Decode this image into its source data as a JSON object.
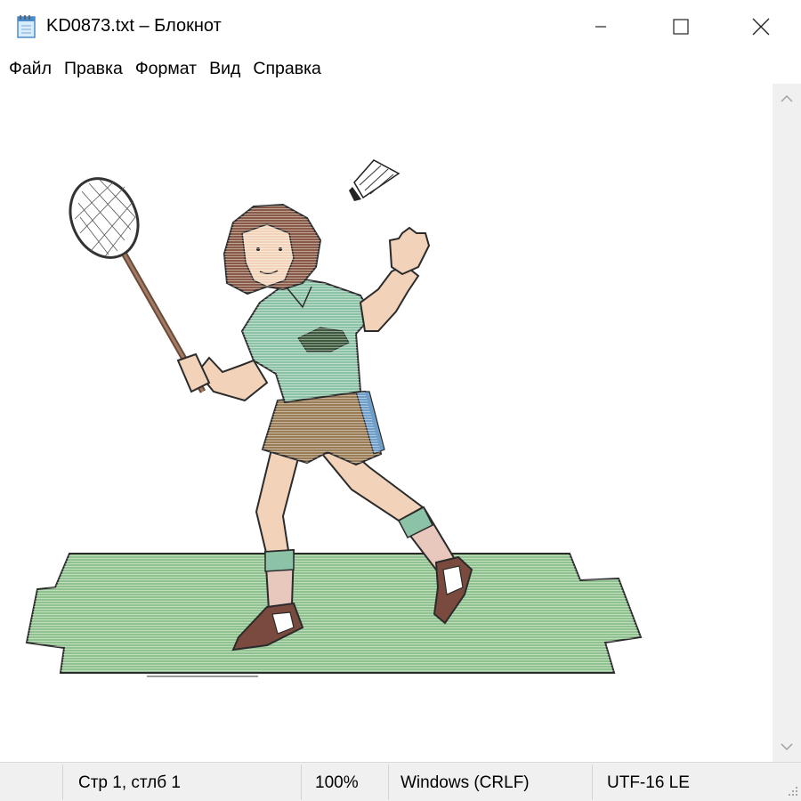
{
  "window": {
    "title": "KD0873.txt – Блокнот",
    "icon": "notepad-icon",
    "controls": [
      "minimize-icon",
      "maximize-icon",
      "close-icon"
    ]
  },
  "menu": [
    "Файл",
    "Правка",
    "Формат",
    "Вид",
    "Справка"
  ],
  "editor": {
    "content_type": "ascii-art",
    "illustration": "badminton-player-icon"
  },
  "status": {
    "position": "Стр 1, стлб 1",
    "zoom": "100%",
    "line_endings": "Windows (CRLF)",
    "encoding": "UTF-16 LE"
  },
  "colors": {
    "chrome": "#ffffff",
    "statusbar": "#f0f0f0",
    "court": "#8fc28f",
    "shirt": "#8cc2a6",
    "hair": "#8a5a48",
    "skin": "#f2d2b8",
    "shorts": "#9a7c56",
    "outline": "#2b2b2b"
  }
}
